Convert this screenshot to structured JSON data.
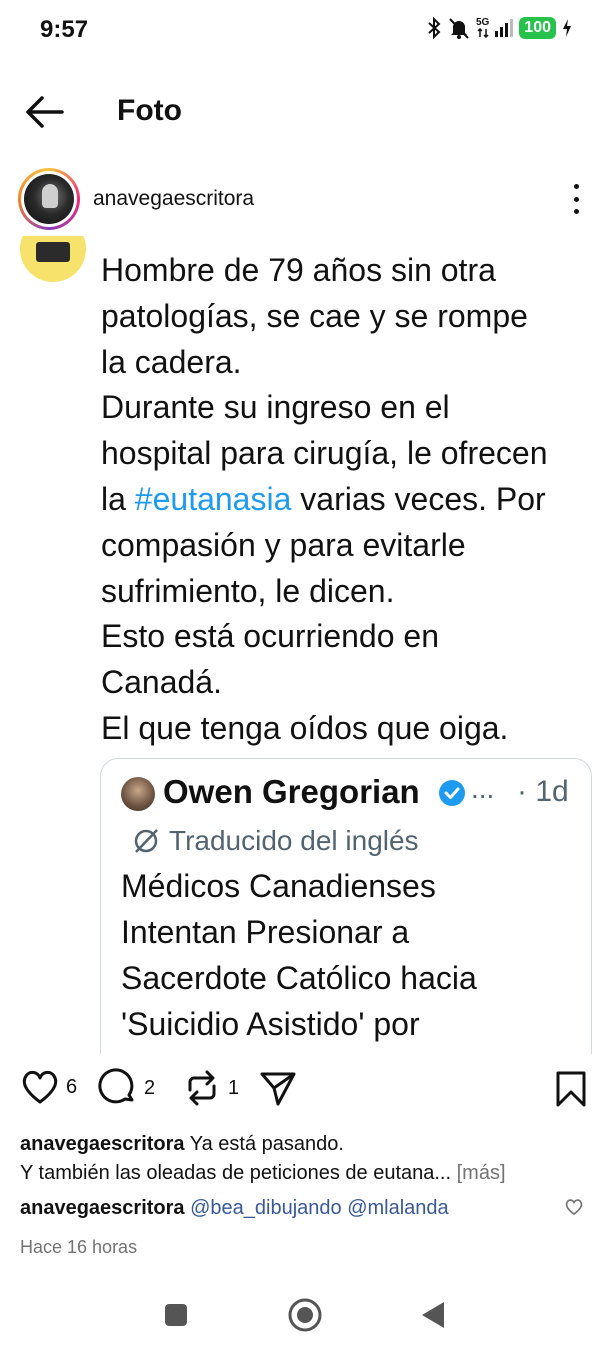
{
  "status_bar": {
    "time": "9:57",
    "network": "5G",
    "battery": "100",
    "icons": [
      "bluetooth-icon",
      "do-not-disturb-icon",
      "signal-icon",
      "battery-icon",
      "charging-icon"
    ]
  },
  "header": {
    "title": "Foto",
    "back_icon": "arrow-left-icon"
  },
  "post": {
    "author": "anavegaescritora",
    "photo": {
      "tweet_lines_before_hashtag": "Hombre de 79 años sin otra\npatologías, se cae y se rompe\nla cadera.\nDurante su ingreso en el\nhospital para cirugía, le ofrecen\nla ",
      "hashtag": "#eutanasia",
      "tweet_lines_after_hashtag": " varias veces. Por\ncompasión y para evitarle\nsufrimiento, le dicen.\nEsto está ocurriendo en\nCanadá.\nEl que tenga oídos que oiga.",
      "quote": {
        "name": "Owen Gregorian",
        "ellipsis": "...",
        "time": "· 1d",
        "translated_label": "Traducido del inglés",
        "text": "Médicos Canadienses\nIntentan Presionar a\nSacerdote Católico hacia\n'Suicidio Asistido' por"
      }
    },
    "actions": {
      "likes": "6",
      "comments": "2",
      "reposts": "1"
    },
    "caption": {
      "user": "anavegaescritora",
      "line1": "Ya está pasando.",
      "line2": "Y también las oleadas de peticiones de eutana...",
      "more": "[más]"
    },
    "comment": {
      "user": "anavegaescritora",
      "mentions": "@bea_dibujando @mlalanda"
    },
    "timestamp": "Hace 16 horas"
  },
  "colors": {
    "hashtag": "#1d9bf0",
    "verified": "#1d9bf0",
    "battery": "#27c24c",
    "muted": "#737373",
    "mention": "#385898"
  }
}
